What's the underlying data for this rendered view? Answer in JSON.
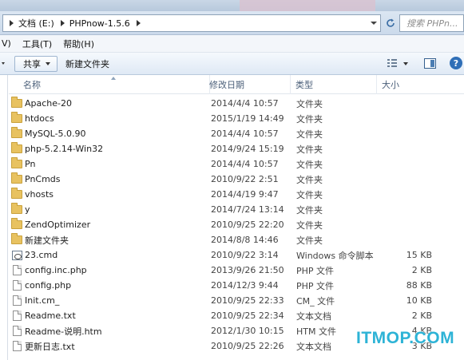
{
  "address": {
    "crumbs": [
      "文档 (E:)",
      "PHPnow-1.5.6"
    ]
  },
  "search": {
    "placeholder": "搜索 PHPn..."
  },
  "menu": {
    "partial_item": "V)",
    "tools": "工具(T)",
    "help": "帮助(H)"
  },
  "toolbar": {
    "share": "共享",
    "new_folder": "新建文件夹"
  },
  "columns": {
    "name": "名称",
    "modified": "修改日期",
    "type": "类型",
    "size": "大小"
  },
  "files": [
    {
      "name": "Apache-20",
      "date": "2014/4/4 10:57",
      "type": "文件夹",
      "size": "",
      "icon": "folder-icon"
    },
    {
      "name": "htdocs",
      "date": "2015/1/19 14:49",
      "type": "文件夹",
      "size": "",
      "icon": "folder-icon"
    },
    {
      "name": "MySQL-5.0.90",
      "date": "2014/4/4 10:57",
      "type": "文件夹",
      "size": "",
      "icon": "folder-icon"
    },
    {
      "name": "php-5.2.14-Win32",
      "date": "2014/9/24 15:19",
      "type": "文件夹",
      "size": "",
      "icon": "folder-icon"
    },
    {
      "name": "Pn",
      "date": "2014/4/4 10:57",
      "type": "文件夹",
      "size": "",
      "icon": "folder-icon"
    },
    {
      "name": "PnCmds",
      "date": "2010/9/22 2:51",
      "type": "文件夹",
      "size": "",
      "icon": "folder-icon"
    },
    {
      "name": "vhosts",
      "date": "2014/4/19 9:47",
      "type": "文件夹",
      "size": "",
      "icon": "folder-icon"
    },
    {
      "name": "y",
      "date": "2014/7/24 13:14",
      "type": "文件夹",
      "size": "",
      "icon": "folder-icon"
    },
    {
      "name": "ZendOptimizer",
      "date": "2010/9/25 22:20",
      "type": "文件夹",
      "size": "",
      "icon": "folder-icon"
    },
    {
      "name": "新建文件夹",
      "date": "2014/8/8 14:46",
      "type": "文件夹",
      "size": "",
      "icon": "folder-icon"
    },
    {
      "name": "23.cmd",
      "date": "2010/9/22 3:14",
      "type": "Windows 命令脚本",
      "size": "15 KB",
      "icon": "cmd-file-icon"
    },
    {
      "name": "config.inc.php",
      "date": "2013/9/26 21:50",
      "type": "PHP 文件",
      "size": "2 KB",
      "icon": "file-icon"
    },
    {
      "name": "config.php",
      "date": "2014/12/3 9:44",
      "type": "PHP 文件",
      "size": "88 KB",
      "icon": "file-icon"
    },
    {
      "name": "Init.cm_",
      "date": "2010/9/25 22:33",
      "type": "CM_ 文件",
      "size": "10 KB",
      "icon": "file-icon"
    },
    {
      "name": "Readme.txt",
      "date": "2010/9/25 22:34",
      "type": "文本文档",
      "size": "2 KB",
      "icon": "file-icon"
    },
    {
      "name": "Readme-说明.htm",
      "date": "2012/1/30 10:15",
      "type": "HTM 文件",
      "size": "4 KB",
      "icon": "file-icon"
    },
    {
      "name": "更新日志.txt",
      "date": "2010/9/25 22:26",
      "type": "文本文档",
      "size": "3 KB",
      "icon": "file-icon"
    }
  ],
  "watermark": "ITMOP.COM",
  "help_glyph": "?"
}
